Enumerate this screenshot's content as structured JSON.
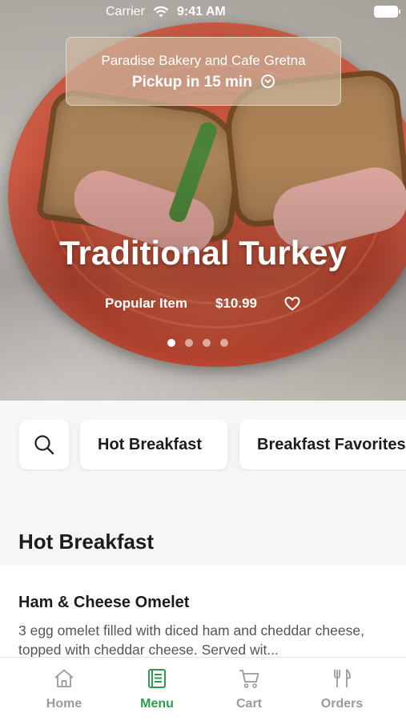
{
  "status_bar": {
    "carrier": "Carrier",
    "time": "9:41 AM"
  },
  "location": {
    "name": "Paradise Bakery and Cafe Gretna",
    "pickup": "Pickup in 15 min"
  },
  "hero": {
    "title": "Traditional Turkey",
    "badge": "Popular Item",
    "price": "$10.99",
    "carousel_total": 4,
    "carousel_active": 1
  },
  "categories": {
    "search_icon": "search-icon",
    "items": [
      "Hot Breakfast",
      "Breakfast Favorites"
    ]
  },
  "section": {
    "title": "Hot Breakfast"
  },
  "menu_item": {
    "name": "Ham & Cheese Omelet",
    "description": "3 egg omelet filled with diced ham and cheddar cheese, topped with cheddar cheese. Served wit..."
  },
  "tabs": [
    {
      "label": "Home",
      "icon": "home-icon"
    },
    {
      "label": "Menu",
      "icon": "menu-book-icon",
      "active": true
    },
    {
      "label": "Cart",
      "icon": "cart-icon"
    },
    {
      "label": "Orders",
      "icon": "fork-knife-icon"
    }
  ],
  "colors": {
    "accent": "#2e9a4e",
    "inactive": "#9a9a9a"
  }
}
